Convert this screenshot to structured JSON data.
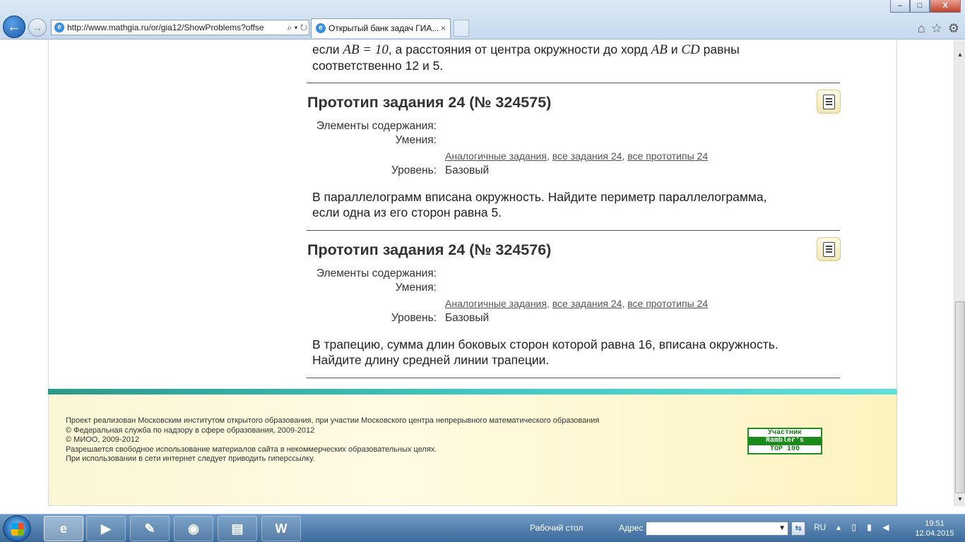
{
  "browser": {
    "url": "http://www.mathgia.ru/or/gia12/ShowProblems?offse",
    "tab_title": "Открытый банк задач ГИА...",
    "tab_close": "×",
    "back": "←",
    "forward": "→",
    "window_minimize": "–",
    "window_maximize": "□",
    "window_close": "X"
  },
  "page": {
    "top_text": {
      "line1_pre": "если ",
      "line1_math1": "AB = 10",
      "line1_mid": ", а расстояния от центра окружности до хорд ",
      "line1_math2": "AB",
      "line1_and": " и ",
      "line1_math3": "CD",
      "line1_post": " равны",
      "line2": "соответственно 12 и 5."
    },
    "problems": [
      {
        "title": "Прототип задания 24 (№ 324575)",
        "label_elements": "Элементы содержания:",
        "label_skills": "Умения:",
        "link_similar": "Аналогичные задания",
        "link_all": "все задания 24",
        "link_prototypes": "все прототипы 24",
        "sep": ",",
        "label_level": "Уровень:",
        "level": "Базовый",
        "text_line1": "В параллелограмм вписана окружность. Найдите периметр параллелограмма,",
        "text_line2": "если одна из его сторон равна 5."
      },
      {
        "title": "Прототип задания 24 (№ 324576)",
        "label_elements": "Элементы содержания:",
        "label_skills": "Умения:",
        "link_similar": "Аналогичные задания",
        "link_all": "все задания 24",
        "link_prototypes": "все прототипы 24",
        "sep": ",",
        "label_level": "Уровень:",
        "level": "Базовый",
        "text_line1": "В трапецию, сумма длин боковых сторон которой равна 16, вписана окружность.",
        "text_line2": "Найдите длину средней линии трапеции."
      }
    ],
    "footer": {
      "line1": "Проект реализован Московским институтом открытого образования, при участии Московского центра непрерывного математического образования",
      "line2": "© Федеральная служба по надзору в сфере образования, 2009-2012",
      "line3": "© МИОО, 2009-2012",
      "line4": "Разрешается свободное использование материалов сайта в некоммерческих образовательных целях.",
      "line5": "При использовании в сети интернет следует приводить гиперссылку.",
      "rambler": [
        "Участник",
        "Rambler's",
        "TOP 100"
      ]
    }
  },
  "taskbar": {
    "desktop_label": "Рабочий стол",
    "address_label": "Адрес",
    "lang": "RU",
    "time": "19:51",
    "date": "12.04.2015"
  },
  "colors": {
    "accent_teal": "#3fc7c0",
    "footer_bg": "#fffbe2",
    "taskbar": "#3c6a9a"
  },
  "icons": [
    "back-icon",
    "forward-icon",
    "ie-icon",
    "document-icon",
    "home-icon",
    "star-icon",
    "gear-icon",
    "windows-start-icon"
  ]
}
